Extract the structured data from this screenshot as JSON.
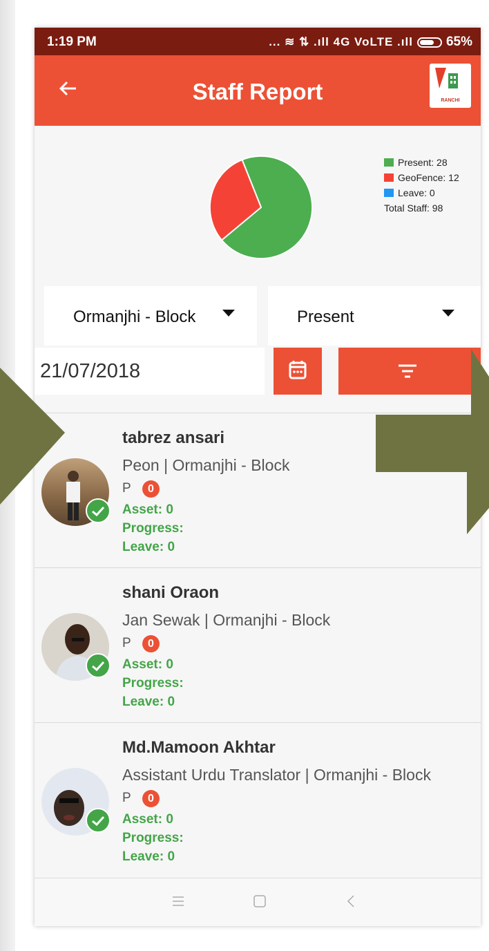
{
  "status_bar": {
    "time": "1:19 PM",
    "indicators": "... ≋ ⇅ .ıll 4G VoLTE .ıll",
    "battery": "65%"
  },
  "app_bar": {
    "title": "Staff Report",
    "logo_text": "RANCHI"
  },
  "chart_data": {
    "type": "pie",
    "slices": [
      {
        "label": "Present",
        "value": 28,
        "color": "#4cae4f"
      },
      {
        "label": "GeoFence",
        "value": 12,
        "color": "#f44336"
      },
      {
        "label": "Leave",
        "value": 0,
        "color": "#2196f3"
      }
    ],
    "legend": {
      "present": "Present: 28",
      "geofence": "GeoFence: 12",
      "leave": "Leave: 0",
      "total": "Total Staff: 98"
    },
    "legend_position": "right"
  },
  "filters": {
    "block": "Ormanjhi - Block",
    "status": "Present",
    "date": "21/07/2018"
  },
  "staff": [
    {
      "name": "tabrez  ansari",
      "role": "Peon | Ormanjhi - Block",
      "status": "P",
      "count": "0",
      "asset": "Asset: 0",
      "progress": "Progress:",
      "leave": "Leave: 0"
    },
    {
      "name": "shani Oraon",
      "role": "Jan Sewak | Ormanjhi - Block",
      "status": "P",
      "count": "0",
      "asset": "Asset: 0",
      "progress": "Progress:",
      "leave": "Leave: 0"
    },
    {
      "name": "Md.Mamoon Akhtar",
      "role": "Assistant Urdu Translator | Ormanjhi - Block",
      "status": "P",
      "count": "0",
      "asset": "Asset: 0",
      "progress": "Progress:",
      "leave": "Leave: 0"
    }
  ],
  "colors": {
    "accent": "#ec5135",
    "status_bar": "#7a1c10",
    "success": "#43a548",
    "overlay_arrow": "#6f7341"
  },
  "icons": {
    "back": "arrow-left-icon",
    "calendar": "calendar-icon",
    "filter": "filter-icon",
    "check": "check-circle-icon",
    "nav_menu": "menu-icon",
    "nav_home": "square-home-icon",
    "nav_back": "chevron-left-icon"
  }
}
